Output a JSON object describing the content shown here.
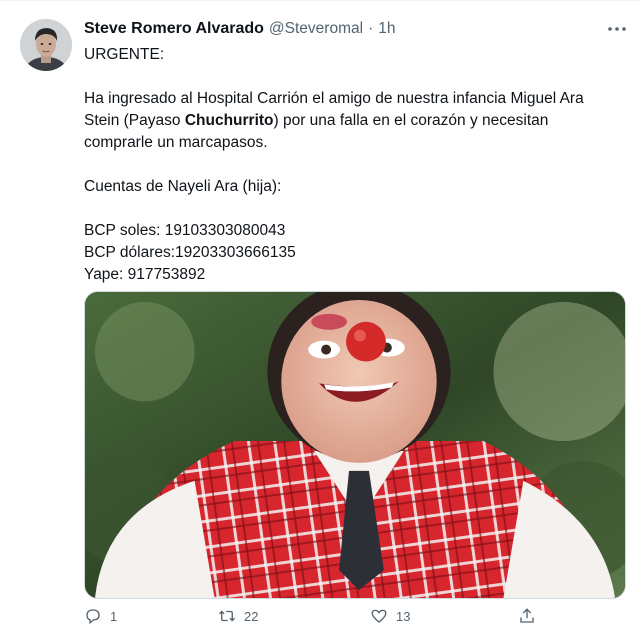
{
  "tweet": {
    "author_name": "Steve Romero Alvarado",
    "author_handle": "@Steveromal",
    "separator": "·",
    "time": "1h",
    "more_label": "···",
    "lines": {
      "l1": "URGENTE:",
      "l2": "Ha ingresado al Hospital Carrión el amigo de nuestra infancia Miguel Ara",
      "l3_a": "Stein (Payaso ",
      "l3_b": "Chuchurrito",
      "l3_c": ") por una falla en el corazón y necesitan",
      "l4": "comprarle un marcapasos.",
      "l5": "Cuentas de Nayeli Ara (hija):",
      "l6": "BCP soles: 19103303080043",
      "l7": "BCP dólares:19203303666135",
      "l8": "Yape: 917753892"
    },
    "actions": {
      "reply_count": "1",
      "retweet_count": "22",
      "like_count": "13",
      "share_count": ""
    }
  },
  "icons": {
    "reply": "reply-icon",
    "retweet": "retweet-icon",
    "like": "heart-icon",
    "share": "share-icon",
    "more": "more-icon"
  },
  "colors": {
    "text_primary": "#0f1419",
    "text_secondary": "#536471",
    "border": "#cfd9de"
  }
}
